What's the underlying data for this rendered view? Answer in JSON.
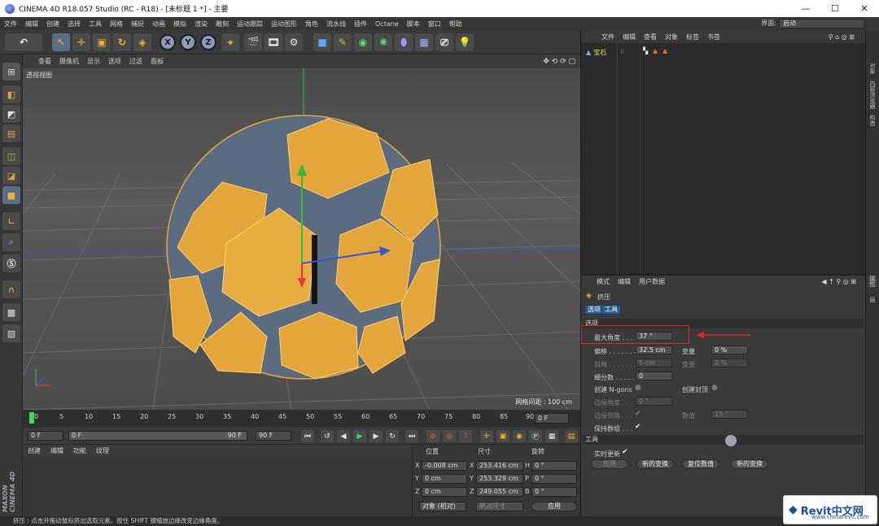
{
  "window": {
    "title": "CINEMA 4D R18.057 Studio (RC - R18) - [未标题 1 *] - 主要",
    "minimize": "—",
    "maximize": "☐",
    "close": "✕"
  },
  "menubar": {
    "items": [
      "文件",
      "编辑",
      "创建",
      "选择",
      "工具",
      "网格",
      "捕捉",
      "动画",
      "模拟",
      "渲染",
      "雕刻",
      "运动跟踪",
      "运动图形",
      "角色",
      "流水线",
      "插件",
      "Octane",
      "脚本",
      "窗口",
      "帮助"
    ],
    "layout_label": "界面:",
    "layout_value": "启动"
  },
  "toolbar": {
    "axis_x": "X",
    "axis_y": "Y",
    "axis_z": "Z"
  },
  "viewport": {
    "menu": [
      "查看",
      "摄像机",
      "显示",
      "选项",
      "过滤",
      "面板"
    ],
    "label": "透视视图",
    "grid_spacing": "网格间距 : 100 cm"
  },
  "timeline": {
    "ticks": [
      "0",
      "5",
      "10",
      "15",
      "20",
      "25",
      "30",
      "35",
      "40",
      "45",
      "50",
      "55",
      "60",
      "65",
      "70",
      "75",
      "80",
      "85",
      "90"
    ],
    "current_frame": "0 F"
  },
  "transport": {
    "start_frame": "0 F",
    "range_start": "0 F",
    "range_end": "90 F",
    "end_frame": "90 F"
  },
  "material": {
    "menu": [
      "创建",
      "编辑",
      "功能",
      "纹理"
    ]
  },
  "coords": {
    "headers": {
      "position": "位置",
      "size": "尺寸",
      "rotation": "旋转"
    },
    "rows": [
      {
        "axis": "X",
        "pos": "-0.008 cm",
        "size_axis": "X",
        "size": "253.416 cm",
        "rot_axis": "H",
        "rot": "0 °"
      },
      {
        "axis": "Y",
        "pos": "0 cm",
        "size_axis": "Y",
        "size": "253.329 cm",
        "rot_axis": "P",
        "rot": "0 °"
      },
      {
        "axis": "Z",
        "pos": "0 cm",
        "size_axis": "Z",
        "size": "249.055 cm",
        "rot_axis": "B",
        "rot": "0 °"
      }
    ],
    "mode": "对象 (相对)",
    "size_mode": "绝对尺寸",
    "apply": "应用"
  },
  "objects": {
    "menu": [
      "文件",
      "编辑",
      "查看",
      "对象",
      "标签",
      "书签"
    ],
    "item": "宝石"
  },
  "attributes": {
    "menu": [
      "模式",
      "编辑",
      "用户数据"
    ],
    "tool_name": "挤压",
    "tabs": [
      "选项",
      "工具"
    ],
    "section_options": "选项",
    "max_angle_label": "最大角度 . . . .",
    "max_angle": "37 °",
    "offset_label": "偏移 . . . . . . .",
    "offset": "32.5 cm",
    "variance_label": "变量",
    "variance": "0 %",
    "bevel_label": "斜角 . . . . . . .",
    "bevel": "5 cm",
    "variance2_label": "变量",
    "variance2": "0 %",
    "subdivision_label": "细分数 . . . . .",
    "subdivision": "0",
    "ngons_label": "创建 N-gons",
    "caps_label": "创建封顶",
    "edge_angle_label": "边缘角度 . . . .",
    "edge_angle": "0 °",
    "edge_bevel_label": "边缘倒角 . . . .",
    "edge_value_label": "数值",
    "edge_value": "15 °",
    "keep_groups_label": "保持群组 . . .",
    "section_tool": "工具",
    "realtime_label": "实时更新",
    "btn_apply": "应用",
    "btn_new_transform": "新的变换",
    "btn_reset": "复位数值",
    "btn_new_transform2": "新的变换"
  },
  "rightbar": {
    "tabs": [
      "对象",
      "内容浏览器",
      "构造",
      "属性",
      "层"
    ]
  },
  "status": {
    "text": "挤压 : 点击并拖动鼠标挤出选取元素。按住 SHIFT 键缩放边缘改变边缘角度。"
  },
  "watermark": {
    "main": "Revit中文网",
    "sub": "www.chinarevit.com"
  },
  "colors": {
    "accent": "#2e5a8a",
    "highlight": "#e0252b",
    "object_label": "#f0d75a",
    "mesh_face": "#e4a63a",
    "mesh_side": "#6f7f94"
  }
}
